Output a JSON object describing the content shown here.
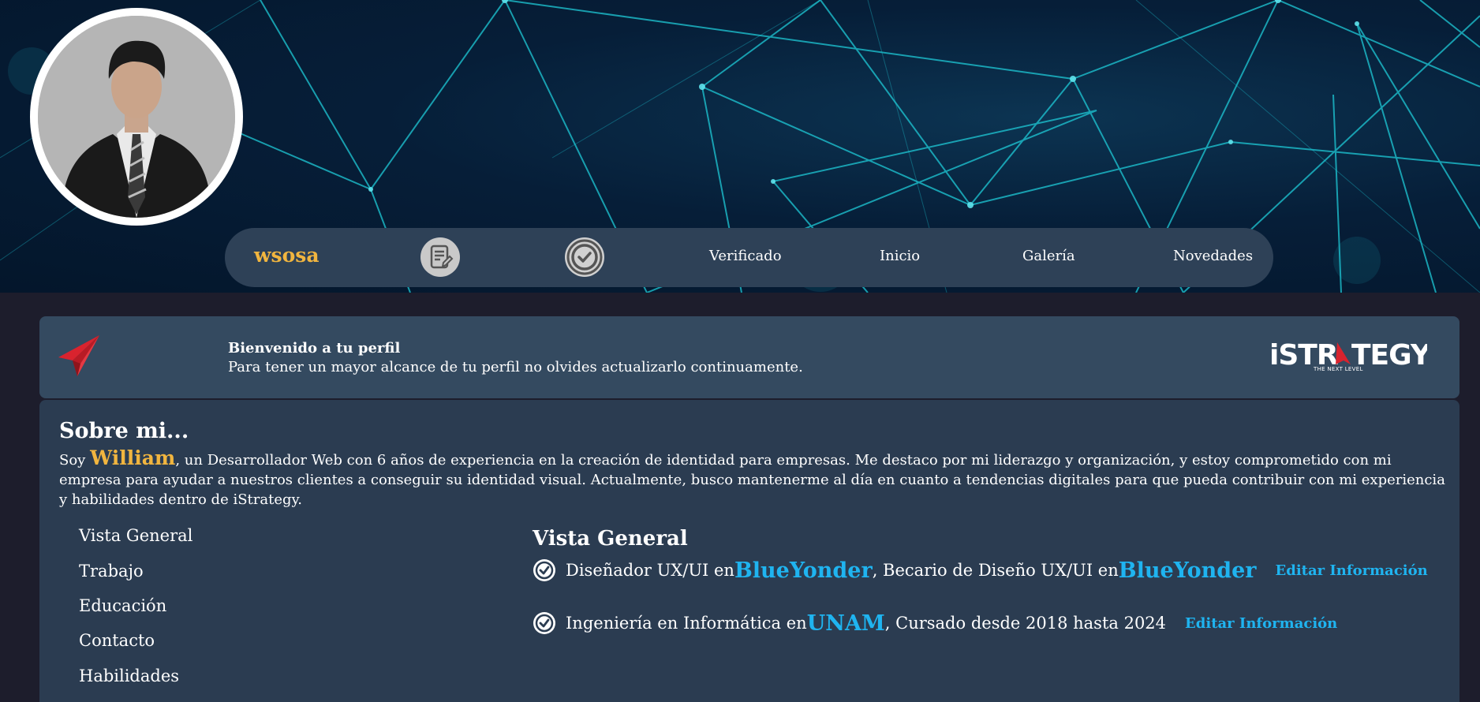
{
  "profile": {
    "username": "wsosa",
    "avatar_alt": "profile photo"
  },
  "nav": {
    "icons": [
      "document-edit-icon",
      "check-circle-icon"
    ],
    "links": [
      "Verificado",
      "Inicio",
      "Galería",
      "Novedades"
    ]
  },
  "welcome": {
    "title": "Bienvenido a tu perfil",
    "text": "Para tener un mayor alcance de tu perfil no olvides actualizarlo continuamente.",
    "brand_name": "iSTRATEGY",
    "brand_tagline": "THE NEXT LEVEL"
  },
  "about": {
    "title": "Sobre mi...",
    "intro": "Soy",
    "name": "William",
    "text": ", un Desarrollador Web con 6 años de experiencia en la creación de identidad para empresas. Me destaco por mi liderazgo y organización, y estoy comprometido con mi empresa para ayudar a nuestros clientes a conseguir su identidad visual. Actualmente, busco mantenerme al día en cuanto a tendencias digitales para que pueda contribuir con mi experiencia y habilidades dentro de iStrategy."
  },
  "side_menu": {
    "items": [
      "Vista General",
      "Trabajo",
      "Educación",
      "Contacto",
      "Habilidades"
    ]
  },
  "overview": {
    "title": "Vista General",
    "rows": [
      {
        "part1": "Diseñador UX/UI en ",
        "hl1": "BlueYonder",
        "part2": ", Becario de Diseño UX/UI en ",
        "hl2": "BlueYonder",
        "edit": "Editar Información"
      },
      {
        "part1": "Ingeniería en Informática en ",
        "hl1": "UNAM",
        "part2": ", Cursado desde 2018 hasta 2024",
        "edit": "Editar Información"
      }
    ]
  },
  "colors": {
    "accent_yellow": "#f1b53f",
    "accent_blue": "#1fb4f0",
    "brand_red": "#d9232e",
    "card_bg": "#2b3c51",
    "banner_bg": "#344a60",
    "page_bg": "#1d1d2c"
  }
}
